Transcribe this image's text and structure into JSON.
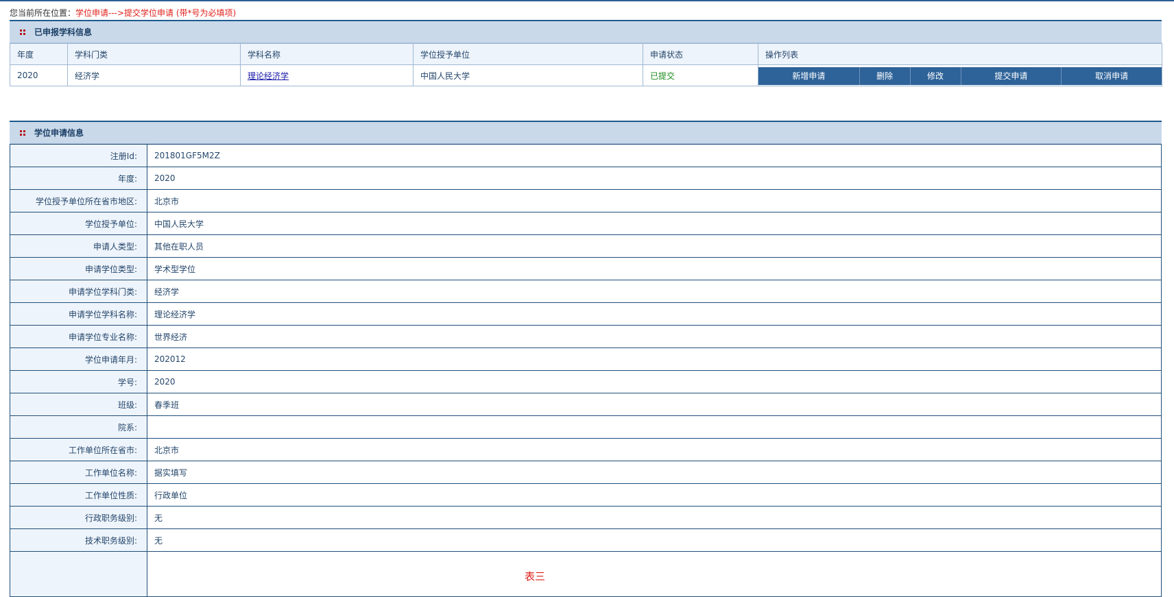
{
  "breadcrumb": {
    "prefix": "您当前所在位置：",
    "path": "学位申请--->提交学位申请 (带*号为必填项)"
  },
  "applied_section": {
    "title": "已申报学科信息",
    "headers": [
      "年度",
      "学科门类",
      "学科名称",
      "学位授予单位",
      "申请状态",
      "操作列表"
    ],
    "row": {
      "year": "2020",
      "category": "经济学",
      "subject": "理论经济学",
      "institution": "中国人民大学",
      "status": "已提交"
    },
    "actions": [
      "新增申请",
      "删除",
      "修改",
      "提交申请",
      "取消申请"
    ]
  },
  "info_section": {
    "title": "学位申请信息",
    "fields": [
      {
        "label": "注册Id:",
        "value": "201801GF5M2Z"
      },
      {
        "label": "年度:",
        "value": "2020"
      },
      {
        "label": "学位授予单位所在省市地区:",
        "value": "北京市"
      },
      {
        "label": "学位授予单位:",
        "value": "中国人民大学"
      },
      {
        "label": "申请人类型:",
        "value": "其他在职人员"
      },
      {
        "label": "申请学位类型:",
        "value": "学术型学位"
      },
      {
        "label": "申请学位学科门类:",
        "value": "经济学"
      },
      {
        "label": "申请学位学科名称:",
        "value": "理论经济学"
      },
      {
        "label": "申请学位专业名称:",
        "value": "世界经济"
      },
      {
        "label": "学位申请年月:",
        "value": "202012"
      },
      {
        "label": "学号:",
        "value": "2020"
      },
      {
        "label": "班级:",
        "value": "春季班"
      },
      {
        "label": "院系:",
        "value": ""
      },
      {
        "label": "工作单位所在省市:",
        "value": "北京市"
      },
      {
        "label": "工作单位名称:",
        "value": "据实填写"
      },
      {
        "label": "工作单位性质:",
        "value": "行政单位"
      },
      {
        "label": "行政职务级别:",
        "value": "无"
      },
      {
        "label": "技术职务级别:",
        "value": "无"
      }
    ],
    "note": "表三"
  }
}
